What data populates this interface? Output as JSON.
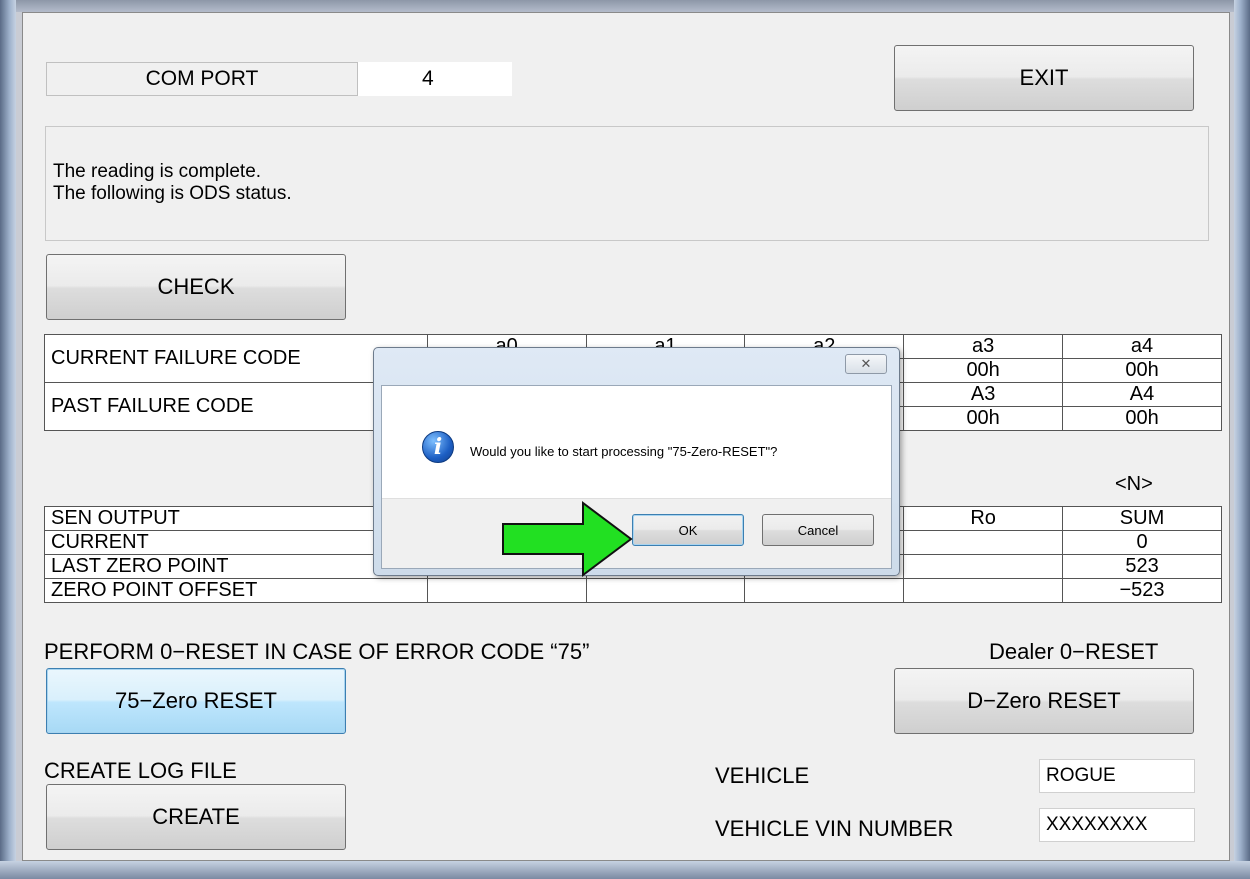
{
  "com_port": {
    "label": "COM PORT",
    "value": "4"
  },
  "exit_label": "EXIT",
  "status": {
    "line1": "The reading is complete.",
    "line2": "The following is ODS status."
  },
  "check_label": "CHECK",
  "failure_table": {
    "current_label": "CURRENT FAILURE CODE",
    "past_label": "PAST FAILURE CODE",
    "current_headers": [
      "a0",
      "a1",
      "a2",
      "a3",
      "a4"
    ],
    "current_values": [
      "",
      "",
      "",
      "00h",
      "00h"
    ],
    "past_headers": [
      "",
      "",
      "",
      "A3",
      "A4"
    ],
    "past_values": [
      "",
      "",
      "",
      "00h",
      "00h"
    ]
  },
  "unit_label": "<N>",
  "sensor_table": {
    "rows": [
      {
        "label": "SEN OUTPUT",
        "ro": "Ro",
        "sum": "SUM"
      },
      {
        "label": "CURRENT",
        "ro": "",
        "sum": "0"
      },
      {
        "label": "LAST ZERO POINT",
        "ro": "",
        "sum": "523"
      },
      {
        "label": "ZERO POINT OFFSET",
        "ro": "",
        "sum": "−523"
      }
    ]
  },
  "perform_label": "PERFORM 0−RESET IN CASE OF ERROR CODE “75”",
  "dealer_label": "Dealer 0−RESET",
  "zero75_label": "75−Zero RESET",
  "dzero_label": "D−Zero RESET",
  "log_label": "CREATE LOG FILE",
  "create_label": "CREATE",
  "vehicle": {
    "label": "VEHICLE",
    "value": "ROGUE"
  },
  "vin": {
    "label": "VEHICLE VIN NUMBER",
    "value": "XXXXXXXX"
  },
  "dialog": {
    "close_glyph": "✕",
    "message": "Would you like to start processing \"75-Zero-RESET\"?",
    "ok_label": "OK",
    "cancel_label": "Cancel"
  },
  "colors": {
    "arrow_fill": "#22e022",
    "arrow_stroke": "#111111"
  }
}
